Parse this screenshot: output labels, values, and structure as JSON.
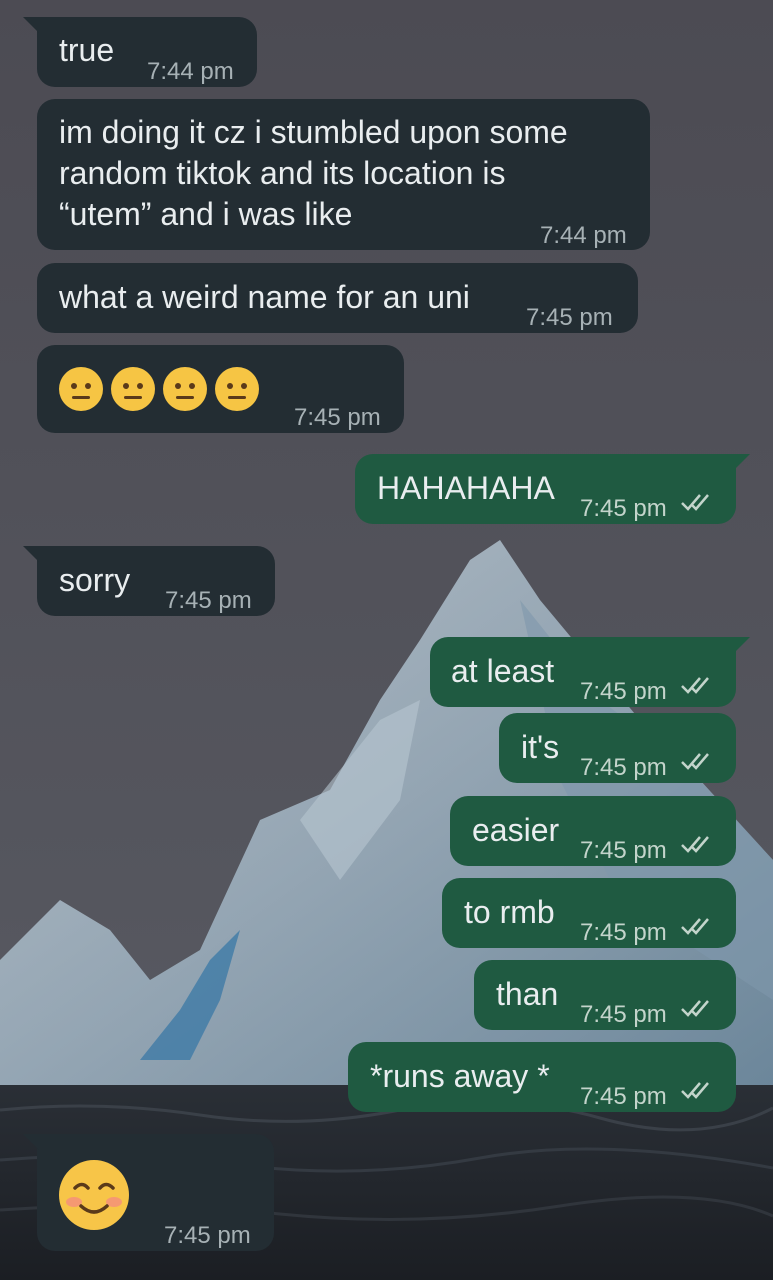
{
  "messages": [
    {
      "text": "true",
      "time": "7:44 pm"
    },
    {
      "text": "im doing it cz i stumbled upon some\nrandom tiktok and its location is\n“utem” and i was like",
      "time": "7:44 pm"
    },
    {
      "text": "what a weird name for an uni",
      "time": "7:45 pm"
    },
    {
      "emoji": "neutral-face x4",
      "time": "7:45 pm"
    },
    {
      "text": "HAHAHAHA",
      "time": "7:45 pm",
      "status": "read"
    },
    {
      "text": "sorry",
      "time": "7:45 pm"
    },
    {
      "text": "at least",
      "time": "7:45 pm",
      "status": "read"
    },
    {
      "text": "it's",
      "time": "7:45 pm",
      "status": "read"
    },
    {
      "text": "easier",
      "time": "7:45 pm",
      "status": "read"
    },
    {
      "text": "to rmb",
      "time": "7:45 pm",
      "status": "read"
    },
    {
      "text": "than",
      "time": "7:45 pm",
      "status": "read"
    },
    {
      "text": "*runs away *",
      "time": "7:45 pm",
      "status": "read"
    },
    {
      "emoji": "smiling-face-with-blush",
      "time": "7:45 pm"
    }
  ],
  "colors": {
    "incoming_bubble": "#232d33",
    "outgoing_bubble": "#1f5a41",
    "text": "#e9edef",
    "timestamp": "#a7b1b5"
  },
  "icons": {
    "read_status": "double-check-icon"
  }
}
